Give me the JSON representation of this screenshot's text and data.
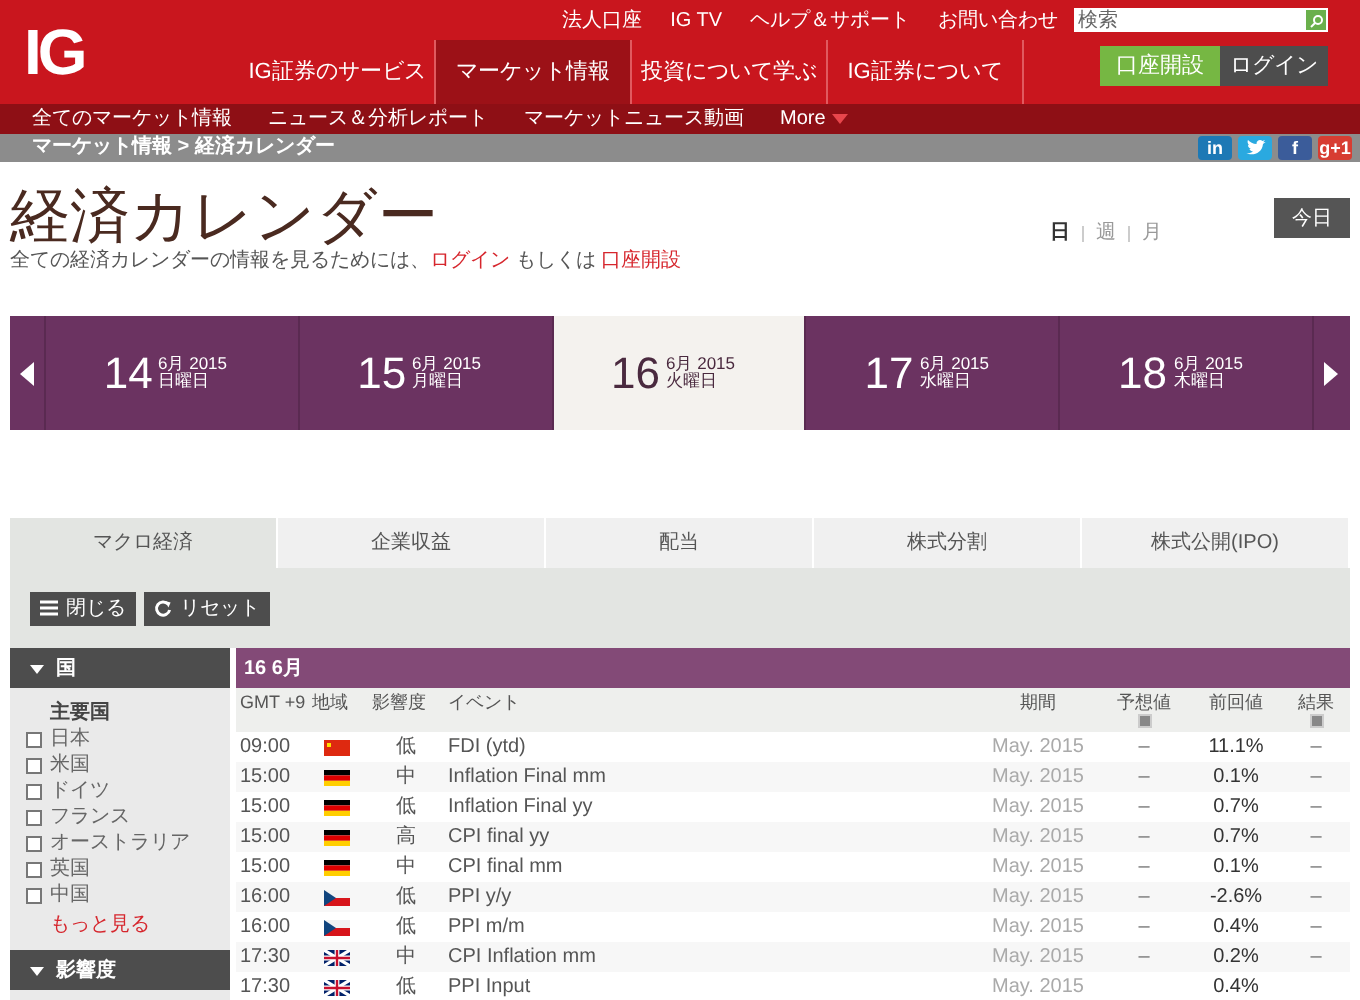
{
  "header": {
    "logo": "IG",
    "top_links": [
      "法人口座",
      "IG TV",
      "ヘルプ＆サポート",
      "お問い合わせ"
    ],
    "search": {
      "placeholder": "検索"
    },
    "nav": [
      {
        "label": "IG証券のサービス",
        "selected": false
      },
      {
        "label": "マーケット情報",
        "selected": true
      },
      {
        "label": "投資について学ぶ",
        "selected": false
      },
      {
        "label": "IG証券について",
        "selected": false
      }
    ],
    "buttons": [
      {
        "label": "口座開設",
        "kind": "primary"
      },
      {
        "label": "ログイン",
        "kind": "secondary"
      }
    ],
    "sub_nav": [
      "全てのマーケット情報",
      "ニュース＆分析レポート",
      "マーケットニュース動画"
    ],
    "more": "More"
  },
  "breadcrumb": "マーケット情報 > 経済カレンダー",
  "social": [
    {
      "kind": "linkedin",
      "label": "in"
    },
    {
      "kind": "twitter"
    },
    {
      "kind": "facebook",
      "label": "f"
    },
    {
      "kind": "googleplus",
      "label": "g+1"
    }
  ],
  "page": {
    "title": "経済カレンダー",
    "notice": "全ての経済カレンダーの情報を見るためには、",
    "login_link": "ログイン",
    "notice_mid": "もしくは",
    "signup_link": "口座開設",
    "views": [
      {
        "label": "日",
        "selected": true
      },
      {
        "label": "週",
        "selected": false
      },
      {
        "label": "月",
        "selected": false
      }
    ],
    "today_button": "今日"
  },
  "days": [
    {
      "day": "14",
      "month_year": "6月 2015",
      "weekday": "日曜日",
      "selected": false
    },
    {
      "day": "15",
      "month_year": "6月 2015",
      "weekday": "月曜日",
      "selected": false
    },
    {
      "day": "16",
      "month_year": "6月 2015",
      "weekday": "火曜日",
      "selected": true
    },
    {
      "day": "17",
      "month_year": "6月 2015",
      "weekday": "水曜日",
      "selected": false
    },
    {
      "day": "18",
      "month_year": "6月 2015",
      "weekday": "木曜日",
      "selected": false
    }
  ],
  "tabs": [
    {
      "label": "マクロ経済",
      "selected": true
    },
    {
      "label": "企業収益",
      "selected": false
    },
    {
      "label": "配当",
      "selected": false
    },
    {
      "label": "株式分割",
      "selected": false
    },
    {
      "label": "株式公開(IPO)",
      "selected": false
    }
  ],
  "toolbar": {
    "close": "閉じる",
    "reset": "リセット"
  },
  "sidebar": [
    {
      "title": "国",
      "expanded": true,
      "group": "主要国",
      "options": [
        {
          "label": "日本",
          "checked": false
        },
        {
          "label": "米国",
          "checked": false
        },
        {
          "label": "ドイツ",
          "checked": false
        },
        {
          "label": "フランス",
          "checked": false
        },
        {
          "label": "オーストラリア",
          "checked": false
        },
        {
          "label": "英国",
          "checked": false
        },
        {
          "label": "中国",
          "checked": false
        }
      ],
      "more": "もっと見る"
    },
    {
      "title": "影響度",
      "expanded": true
    }
  ],
  "table": {
    "date_heading": "16 6月",
    "columns": [
      {
        "label": "GMT +9"
      },
      {
        "label": "地域"
      },
      {
        "label": "影響度"
      },
      {
        "label": "イベント"
      },
      {
        "label": "期間"
      },
      {
        "label": "予想値",
        "toggle": true
      },
      {
        "label": "前回値"
      },
      {
        "label": "結果",
        "toggle": true
      }
    ],
    "rows": [
      {
        "time": "09:00",
        "kind": "cn",
        "impact": "低",
        "event": "FDI (ytd)",
        "period": "May. 2015",
        "forecast": "–",
        "previous": "11.1%",
        "actual": "–"
      },
      {
        "time": "15:00",
        "kind": "de",
        "impact": "中",
        "event": "Inflation Final mm",
        "period": "May. 2015",
        "forecast": "–",
        "previous": "0.1%",
        "actual": "–"
      },
      {
        "time": "15:00",
        "kind": "de",
        "impact": "低",
        "event": "Inflation Final yy",
        "period": "May. 2015",
        "forecast": "–",
        "previous": "0.7%",
        "actual": "–"
      },
      {
        "time": "15:00",
        "kind": "de",
        "impact": "高",
        "event": "CPI final yy",
        "period": "May. 2015",
        "forecast": "–",
        "previous": "0.7%",
        "actual": "–"
      },
      {
        "time": "15:00",
        "kind": "de",
        "impact": "中",
        "event": "CPI final mm",
        "period": "May. 2015",
        "forecast": "–",
        "previous": "0.1%",
        "actual": "–"
      },
      {
        "time": "16:00",
        "kind": "cz",
        "impact": "低",
        "event": "PPI y/y",
        "period": "May. 2015",
        "forecast": "–",
        "previous": "-2.6%",
        "actual": "–"
      },
      {
        "time": "16:00",
        "kind": "cz",
        "impact": "低",
        "event": "PPI m/m",
        "period": "May. 2015",
        "forecast": "–",
        "previous": "0.4%",
        "actual": "–"
      },
      {
        "time": "17:30",
        "kind": "gb",
        "impact": "中",
        "event": "CPI Inflation mm",
        "period": "May. 2015",
        "forecast": "–",
        "previous": "0.2%",
        "actual": "–"
      },
      {
        "time": "17:30",
        "kind": "gb",
        "impact": "低",
        "event": "PPI Input",
        "period": "May. 2015",
        "previous": "0.4%"
      }
    ]
  }
}
